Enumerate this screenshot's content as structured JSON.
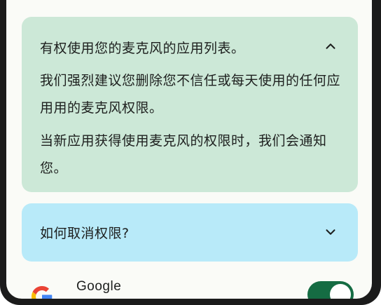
{
  "accordion_permitted": {
    "title": "有权使用您的麦克风的应用列表。",
    "expanded": true,
    "paragraph_1": "我们强烈建议您删除您不信任或每天使用的任何应用用的麦克风权限。",
    "paragraph_2": "当新应用获得使用麦克风的权限时，我们会通知您。",
    "background": "#cce8d7",
    "icon": "chevron-up-icon"
  },
  "accordion_revoke": {
    "title": "如何取消权限?",
    "expanded": false,
    "background": "#b8eaf9",
    "icon": "chevron-down-icon"
  },
  "app_list": [
    {
      "name": "Google",
      "icon": "google-logo-icon",
      "permission_enabled": true,
      "toggle_color": "#156c43"
    }
  ]
}
